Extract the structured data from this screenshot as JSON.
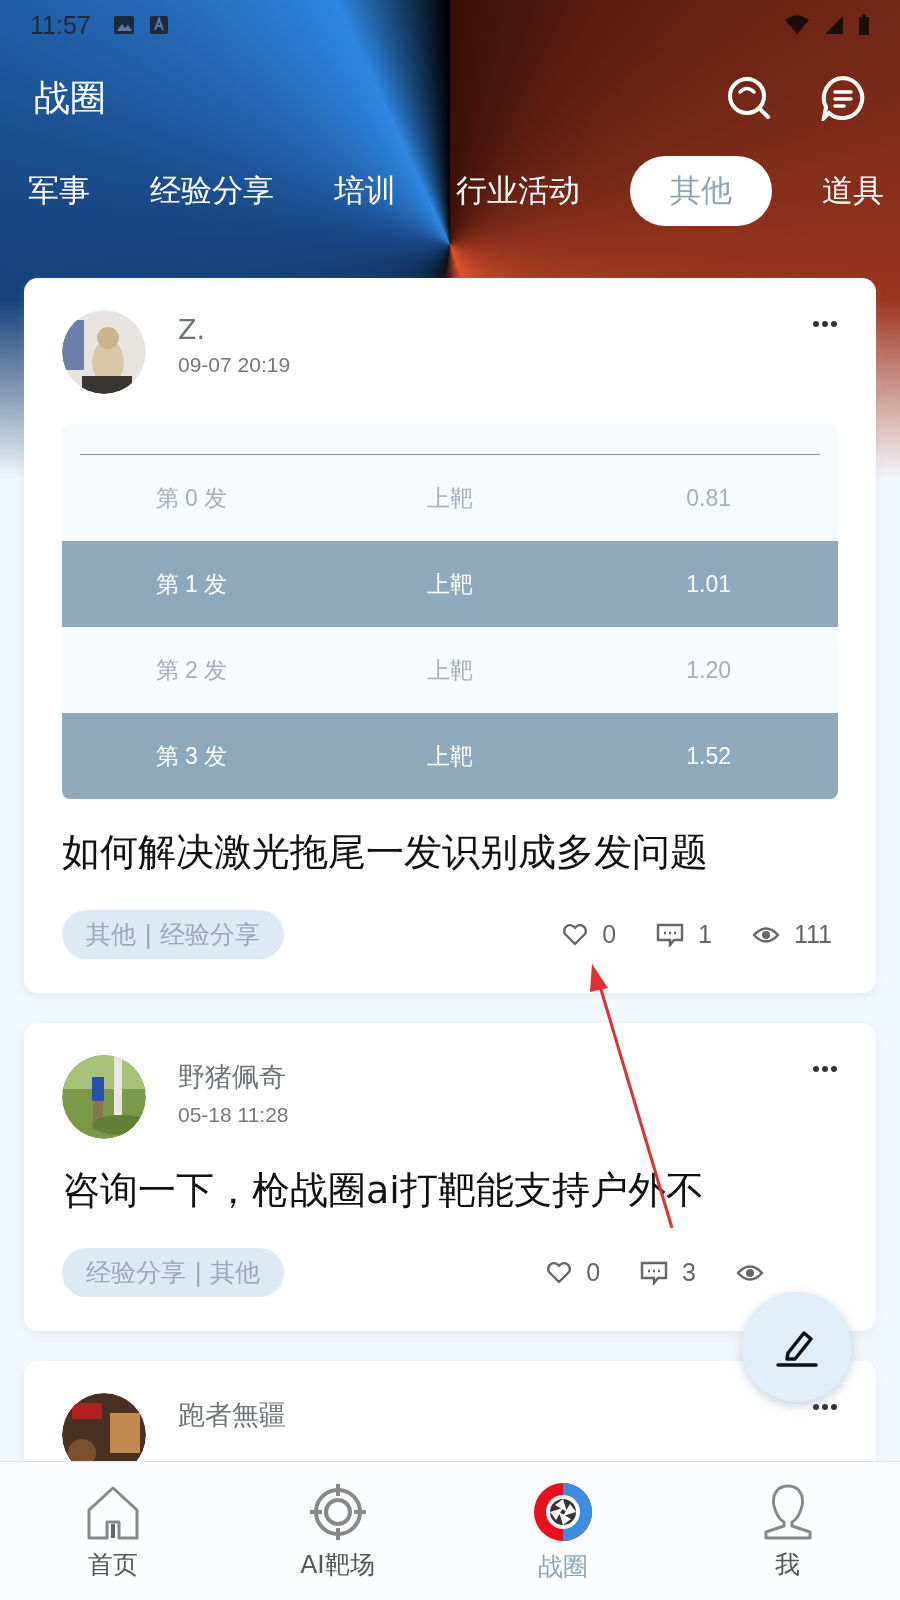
{
  "status_bar": {
    "time": "11:57"
  },
  "header": {
    "title": "战圈"
  },
  "tabs": [
    {
      "label": "军事",
      "selected": false
    },
    {
      "label": "经验分享",
      "selected": false
    },
    {
      "label": "培训",
      "selected": false
    },
    {
      "label": "行业活动",
      "selected": false
    },
    {
      "label": "其他",
      "selected": true
    },
    {
      "label": "道具",
      "selected": false
    }
  ],
  "posts": [
    {
      "author": "Z.",
      "time": "09-07 20:19",
      "image_table": {
        "rows": [
          {
            "cells": [
              "第 0 发",
              "上靶",
              "0.81"
            ],
            "shaded": false
          },
          {
            "cells": [
              "第 1 发",
              "上靶",
              "1.01"
            ],
            "shaded": true
          },
          {
            "cells": [
              "第 2 发",
              "上靶",
              "1.20"
            ],
            "shaded": false
          },
          {
            "cells": [
              "第 3 发",
              "上靶",
              "1.52"
            ],
            "shaded": true
          }
        ]
      },
      "title": "如何解决激光拖尾一发识别成多发问题",
      "tags": "其他 | 经验分享",
      "likes": "0",
      "comments": "1",
      "views": "111"
    },
    {
      "author": "野猪佩奇",
      "time": "05-18 11:28",
      "title": "咨询一下，枪战圈ai打靶能支持户外不",
      "tags": "经验分享 | 其他",
      "likes": "0",
      "comments": "3"
    },
    {
      "author": "跑者無疆"
    }
  ],
  "bottom_nav": [
    {
      "label": "首页",
      "selected": false,
      "kind": "home"
    },
    {
      "label": "AI靶场",
      "selected": false,
      "kind": "target"
    },
    {
      "label": "战圈",
      "selected": true,
      "kind": "circle"
    },
    {
      "label": "我",
      "selected": false,
      "kind": "profile"
    }
  ]
}
